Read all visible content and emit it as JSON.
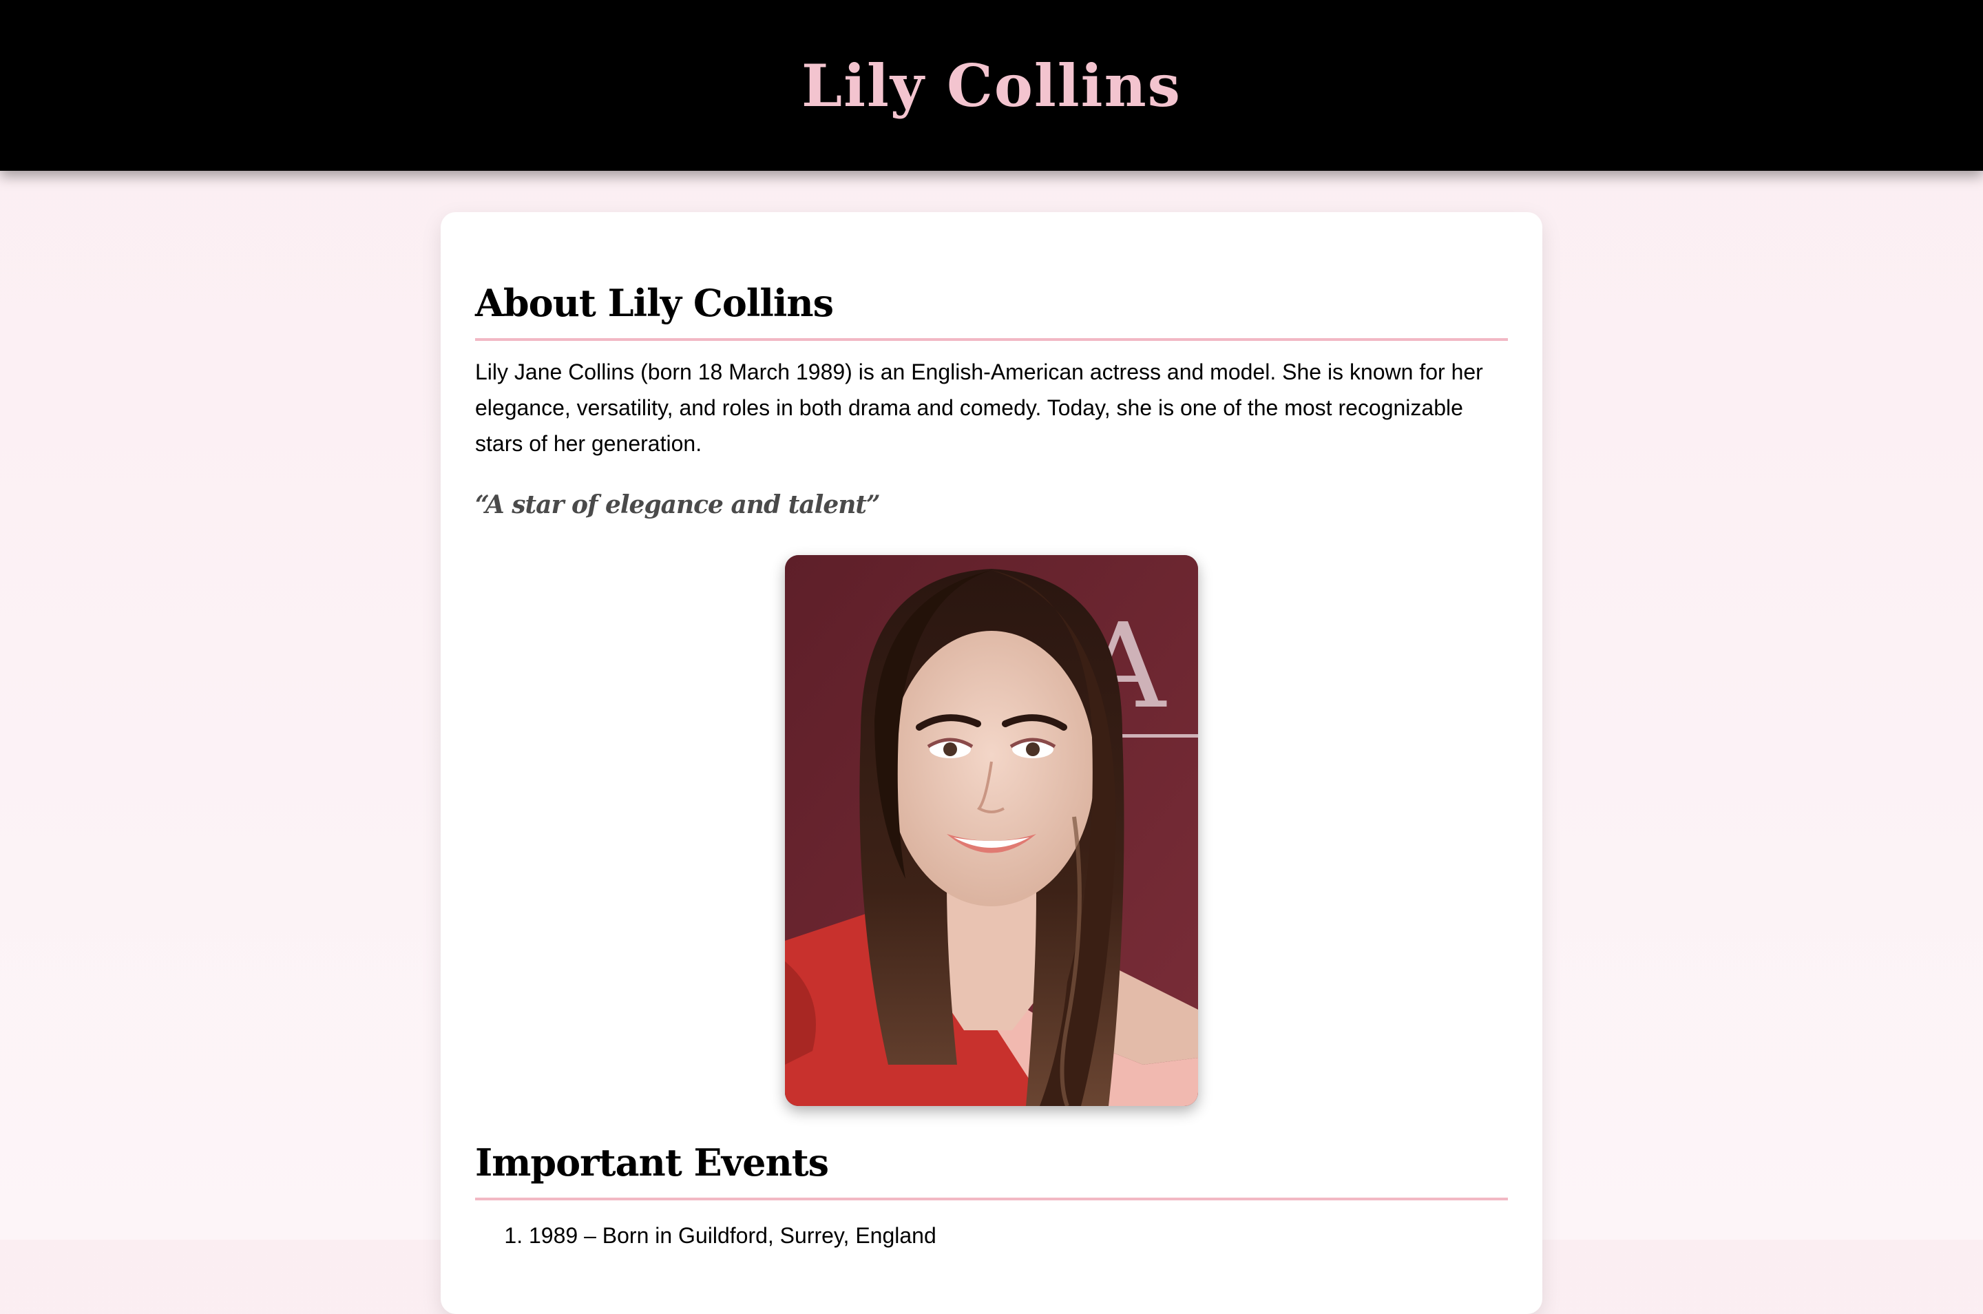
{
  "header": {
    "title": "Lily Collins"
  },
  "about": {
    "heading": "About Lily Collins",
    "bio": "Lily Jane Collins (born 18 March 1989) is an English-American actress and model. She is known for her elegance, versatility, and roles in both drama and comedy. Today, she is one of the most recognizable stars of her generation.",
    "quote": "“A star of elegance and talent”"
  },
  "portrait": {
    "alt": "Lily Collins portrait"
  },
  "events": {
    "heading": "Important Events",
    "items": [
      "1989 – Born in Guildford, Surrey, England"
    ]
  },
  "colors": {
    "header_bg": "#000000",
    "title_pink": "#f3c4cf",
    "rule_pink": "#f2b8c4",
    "page_bg": "#fbeef2"
  }
}
